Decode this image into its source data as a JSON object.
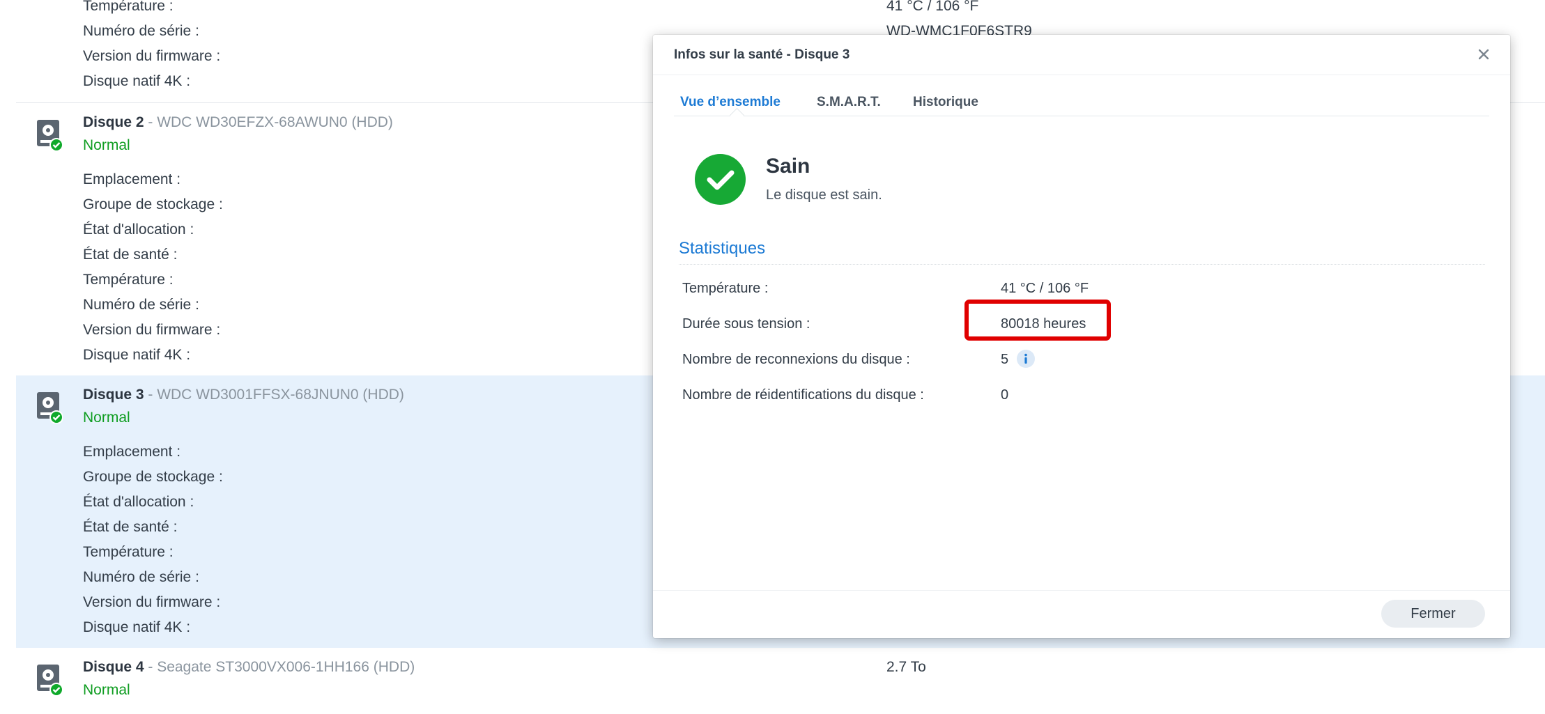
{
  "disk1_partial": {
    "labels": [
      "Température :",
      "Numéro de série :",
      "Version du firmware :",
      "Disque natif 4K :"
    ],
    "temperature_value": "41 °C / 106 °F",
    "serial_value": "WD-WMC1F0F6STR9"
  },
  "disk2": {
    "name": "Disque 2",
    "model": " - WDC WD30EFZX-68AWUN0 (HDD)",
    "status": "Normal",
    "labels": [
      "Emplacement :",
      "Groupe de stockage :",
      "État d'allocation :",
      "État de santé :",
      "Température :",
      "Numéro de série :",
      "Version du firmware :",
      "Disque natif 4K :"
    ]
  },
  "disk3": {
    "name": "Disque 3",
    "model": " - WDC WD3001FFSX-68JNUN0 (HDD)",
    "status": "Normal",
    "labels": [
      "Emplacement :",
      "Groupe de stockage :",
      "État d'allocation :",
      "État de santé :",
      "Température :",
      "Numéro de série :",
      "Version du firmware :",
      "Disque natif 4K :"
    ]
  },
  "disk4": {
    "name": "Disque 4",
    "model": " - Seagate ST3000VX006-1HH166 (HDD)",
    "status": "Normal",
    "capacity": "2.7 To"
  },
  "modal": {
    "title": "Infos sur la santé - Disque 3",
    "tabs": [
      "Vue d’ensemble",
      "S.M.A.R.T.",
      "Historique"
    ],
    "health_title": "Sain",
    "health_desc": "Le disque est sain.",
    "stats_title": "Statistiques",
    "stats": [
      {
        "label": "Température :",
        "value": "41 °C / 106 °F"
      },
      {
        "label": "Durée sous tension :",
        "value": "80018 heures"
      },
      {
        "label": "Nombre de reconnexions du disque :",
        "value": "5"
      },
      {
        "label": "Nombre de réidentifications du disque :",
        "value": "0"
      }
    ],
    "close_label": "Fermer"
  },
  "colors": {
    "accent": "#1c7ad4",
    "ok_green": "#0f9d21",
    "highlight_red": "#e00000",
    "selected_row": "#e6f1fc"
  },
  "icons": [
    "hdd-icon",
    "check-badge-icon",
    "close-icon",
    "check-circle-icon",
    "info-icon"
  ]
}
